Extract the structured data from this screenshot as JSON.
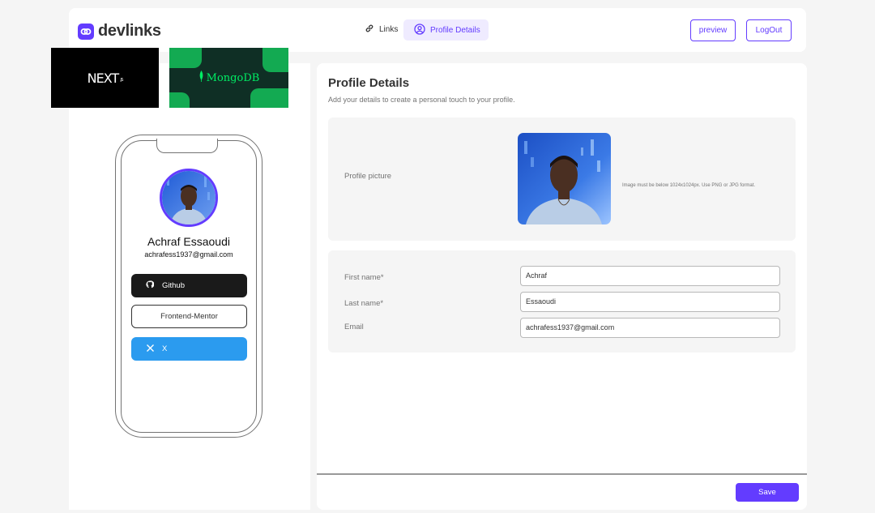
{
  "header": {
    "logo_text": "devlinks",
    "nav": {
      "links_label": "Links",
      "profile_label": "Profile Details"
    },
    "preview_label": "preview",
    "logout_label": "LogOut"
  },
  "thumbnails": {
    "next_text": "NEXT",
    "next_sub": ".JS",
    "mongo_text": "MongoDB"
  },
  "phone": {
    "name": "Achraf Essaoudi",
    "email": "achrafess1937@gmail.com",
    "links": [
      {
        "label": "Github",
        "icon": "github-icon",
        "color": "#1a1a1a"
      },
      {
        "label": "Frontend-Mentor",
        "icon": "frontend-mentor-icon",
        "color": "#ffffff"
      },
      {
        "label": "X",
        "icon": "x-icon",
        "color": "#2b9bef"
      }
    ]
  },
  "form": {
    "title": "Profile Details",
    "subtitle": "Add your details to create a personal touch to your profile.",
    "picture_label": "Profile picture",
    "picture_hint": "Image must be below 1024x1024px. Use PNG or JPG format.",
    "first_name_label": "First name*",
    "first_name_value": "Achraf",
    "last_name_label": "Last name*",
    "last_name_value": "Essaoudi",
    "email_label": "Email",
    "email_value": "achrafess1937@gmail.com",
    "save_label": "Save"
  },
  "colors": {
    "accent": "#633cff",
    "accent_light": "#efebff",
    "github": "#1a1a1a",
    "x": "#2b9bef"
  }
}
